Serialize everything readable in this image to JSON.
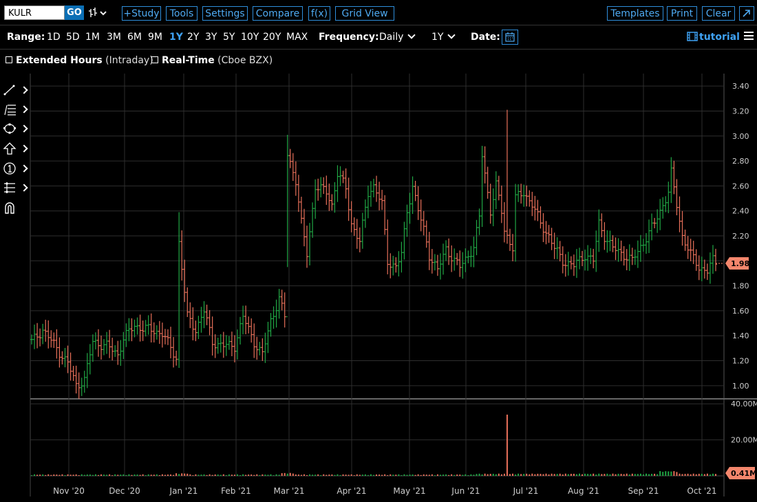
{
  "toolbar": {
    "symbol": "KULR",
    "go_label": "GO",
    "buttons": {
      "study": "+Study",
      "tools": "Tools",
      "settings": "Settings",
      "compare": "Compare",
      "fx": "f(x)",
      "grid_view": "Grid View",
      "templates": "Templates",
      "print": "Print",
      "clear": "Clear"
    }
  },
  "range_bar": {
    "range_label": "Range:",
    "ranges": [
      "1D",
      "5D",
      "1M",
      "3M",
      "6M",
      "9M",
      "1Y",
      "2Y",
      "3Y",
      "5Y",
      "10Y",
      "20Y",
      "MAX"
    ],
    "selected_range": "1Y",
    "frequency_label": "Frequency:",
    "frequency_value": "Daily",
    "period_value": "1Y",
    "date_label": "Date:",
    "tutorial_label": "tutorial"
  },
  "options": {
    "extended_hours_label": "Extended Hours",
    "extended_hours_note": "(Intraday)",
    "extended_hours_checked": false,
    "realtime_label": "Real-Time",
    "realtime_note": "(Cboe BZX)",
    "realtime_checked": false
  },
  "drawing_tools": [
    "line-tool-icon",
    "fib-tool-icon",
    "shape-tool-icon",
    "arrow-tool-icon",
    "annotation-tool-icon",
    "measure-tool-icon",
    "magnet-icon"
  ],
  "colors": {
    "up": "#20a845",
    "down": "#e8705a",
    "grid": "#2e2e2e",
    "accent": "#3fa2f4",
    "price_tag": "#f4866c"
  },
  "chart_data": {
    "type": "ohlc",
    "symbol": "KULR",
    "x_ticks": [
      "Nov '20",
      "Dec '20",
      "Jan '21",
      "Feb '21",
      "Mar '21",
      "Apr '21",
      "May '21",
      "Jun '21",
      "Jul '21",
      "Aug '21",
      "Sep '21",
      "Oct '21"
    ],
    "price_ticks": [
      "3.40",
      "3.20",
      "3.00",
      "2.80",
      "2.60",
      "2.40",
      "2.20",
      "2.00",
      "1.80",
      "1.60",
      "1.40",
      "1.20",
      "1.00"
    ],
    "ylim": [
      0.9,
      3.5
    ],
    "volume_ticks": [
      "40.00M",
      "20.00M"
    ],
    "volume_ylim": [
      0,
      42
    ],
    "last_price": "1.98",
    "last_volume": "0.41M",
    "volume_unit": "M",
    "price_anchors": [
      [
        0,
        1.35
      ],
      [
        4,
        1.45
      ],
      [
        9,
        1.3
      ],
      [
        13,
        1.18
      ],
      [
        16,
        1.0
      ],
      [
        19,
        1.05
      ],
      [
        22,
        1.35
      ],
      [
        27,
        1.32
      ],
      [
        31,
        1.25
      ],
      [
        33,
        1.38
      ],
      [
        37,
        1.48
      ],
      [
        42,
        1.45
      ],
      [
        47,
        1.42
      ],
      [
        52,
        1.22
      ],
      [
        53,
        2.15
      ],
      [
        56,
        1.55
      ],
      [
        59,
        1.45
      ],
      [
        62,
        1.6
      ],
      [
        65,
        1.35
      ],
      [
        69,
        1.32
      ],
      [
        73,
        1.32
      ],
      [
        76,
        1.55
      ],
      [
        80,
        1.35
      ],
      [
        83,
        1.25
      ],
      [
        86,
        1.52
      ],
      [
        89,
        1.7
      ],
      [
        91,
        1.55
      ],
      [
        92,
        2.85
      ],
      [
        95,
        2.65
      ],
      [
        97,
        2.3
      ],
      [
        99,
        2.05
      ],
      [
        102,
        2.6
      ],
      [
        106,
        2.55
      ],
      [
        108,
        2.45
      ],
      [
        110,
        2.7
      ],
      [
        113,
        2.58
      ],
      [
        115,
        2.3
      ],
      [
        118,
        2.15
      ],
      [
        121,
        2.55
      ],
      [
        123,
        2.6
      ],
      [
        126,
        2.45
      ],
      [
        128,
        2.0
      ],
      [
        131,
        1.95
      ],
      [
        133,
        2.05
      ],
      [
        135,
        2.4
      ],
      [
        137,
        2.6
      ],
      [
        139,
        2.4
      ],
      [
        141,
        2.25
      ],
      [
        143,
        2.05
      ],
      [
        146,
        1.92
      ],
      [
        149,
        2.1
      ],
      [
        152,
        2.0
      ],
      [
        154,
        1.95
      ],
      [
        157,
        2.05
      ],
      [
        159,
        2.1
      ],
      [
        161,
        2.35
      ],
      [
        162,
        2.85
      ],
      [
        165,
        2.4
      ],
      [
        167,
        2.6
      ],
      [
        169,
        2.4
      ],
      [
        170,
        2.25
      ],
      [
        171,
        2.2
      ],
      [
        173,
        2.1
      ],
      [
        174,
        2.5
      ],
      [
        177,
        2.55
      ],
      [
        180,
        2.45
      ],
      [
        183,
        2.3
      ],
      [
        186,
        2.2
      ],
      [
        188,
        2.1
      ],
      [
        191,
        2.0
      ],
      [
        195,
        1.96
      ],
      [
        199,
        2.05
      ],
      [
        202,
        2.0
      ],
      [
        204,
        2.3
      ],
      [
        206,
        2.2
      ],
      [
        209,
        2.1
      ],
      [
        213,
        2.05
      ],
      [
        216,
        2.0
      ],
      [
        220,
        2.15
      ],
      [
        224,
        2.3
      ],
      [
        227,
        2.45
      ],
      [
        229,
        2.55
      ],
      [
        230,
        2.7
      ],
      [
        232,
        2.45
      ],
      [
        234,
        2.2
      ],
      [
        237,
        2.05
      ],
      [
        240,
        1.95
      ],
      [
        243,
        1.92
      ],
      [
        245,
        2.0
      ],
      [
        246,
        1.98
      ]
    ],
    "volume_spike": {
      "date": "Jun '21",
      "value": 34.0
    }
  }
}
